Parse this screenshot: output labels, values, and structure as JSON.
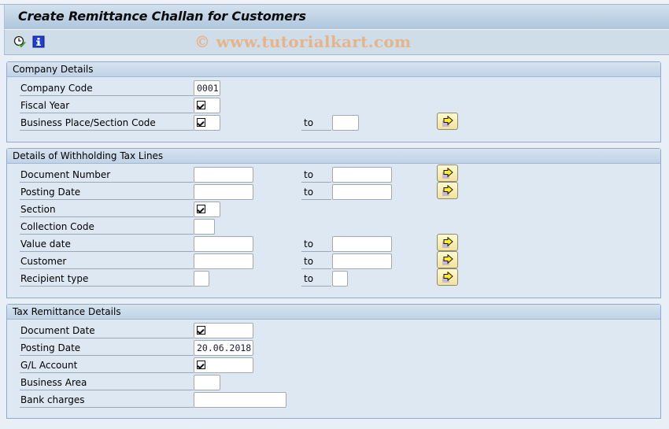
{
  "window": {
    "title": "Create Remittance Challan for Customers"
  },
  "toolbar": {
    "icons": [
      {
        "name": "execute-clock-icon",
        "tooltip": ""
      },
      {
        "name": "info-icon",
        "tooltip": ""
      }
    ],
    "watermark": "© www.tutorialkart.com"
  },
  "colors": {
    "title_gradient_top": "#d3e1ee",
    "title_gradient_bottom": "#afc6dd",
    "group_bg": "#dde8f3",
    "multi_btn_bg": "#f5e9a8",
    "watermark": "#e6b48a"
  },
  "groups": {
    "company": {
      "title": "Company Details",
      "rows": [
        {
          "label": "Company Code",
          "value": "0001"
        },
        {
          "label": "Fiscal Year",
          "value": "",
          "required": true
        },
        {
          "label": "Business Place/Section Code",
          "value": "",
          "required": true,
          "to_label": "to",
          "to_value": ""
        }
      ]
    },
    "withholding": {
      "title": "Details of Withholding Tax Lines",
      "rows": [
        {
          "label": "Document Number",
          "value": "",
          "to_label": "to",
          "to_value": ""
        },
        {
          "label": "Posting Date",
          "value": "",
          "to_label": "to",
          "to_value": ""
        },
        {
          "label": "Section",
          "value": "",
          "required": true
        },
        {
          "label": "Collection Code",
          "value": ""
        },
        {
          "label": "Value date",
          "value": "",
          "to_label": "to",
          "to_value": ""
        },
        {
          "label": "Customer",
          "value": "",
          "to_label": "to",
          "to_value": ""
        },
        {
          "label": "Recipient type",
          "value": "",
          "to_label": "to",
          "to_value": ""
        }
      ]
    },
    "remittance": {
      "title": "Tax Remittance Details",
      "rows": [
        {
          "label": "Document Date",
          "value": "",
          "required": true
        },
        {
          "label": "Posting Date",
          "value": "20.06.2018"
        },
        {
          "label": "G/L Account",
          "value": "",
          "required": true
        },
        {
          "label": "Business Area",
          "value": ""
        },
        {
          "label": "Bank charges",
          "value": ""
        }
      ]
    }
  }
}
